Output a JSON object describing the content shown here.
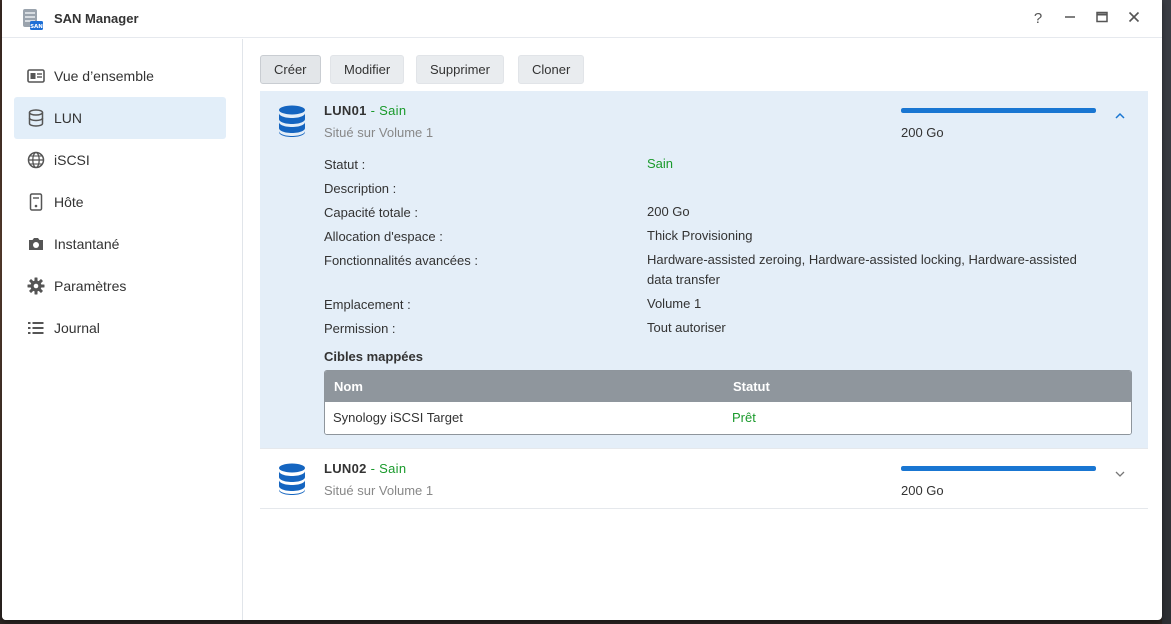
{
  "window": {
    "title": "SAN Manager"
  },
  "titlebar_buttons": {
    "help": "?",
    "minimize": "—",
    "maximize": "▭",
    "close": "✕"
  },
  "sidebar": {
    "items": [
      {
        "label": "Vue d’ensemble",
        "icon": "overview-icon",
        "active": false
      },
      {
        "label": "LUN",
        "icon": "database-icon",
        "active": true
      },
      {
        "label": "iSCSI",
        "icon": "globe-icon",
        "active": false
      },
      {
        "label": "Hôte",
        "icon": "host-icon",
        "active": false
      },
      {
        "label": "Instantané",
        "icon": "camera-icon",
        "active": false
      },
      {
        "label": "Paramètres",
        "icon": "gear-icon",
        "active": false
      },
      {
        "label": "Journal",
        "icon": "list-icon",
        "active": false
      }
    ]
  },
  "toolbar": {
    "create": "Créer",
    "modify": "Modifier",
    "delete": "Supprimer",
    "clone": "Cloner"
  },
  "luns": [
    {
      "name": "LUN01",
      "separator": " - ",
      "status": "Sain",
      "location": "Situé sur Volume 1",
      "capacity": "200 Go",
      "usage_fraction": 1.0,
      "expanded": true,
      "details": [
        {
          "label": "Statut :",
          "value": "Sain"
        },
        {
          "label": "Description :",
          "value": ""
        },
        {
          "label": "Capacité totale :",
          "value": "200 Go"
        },
        {
          "label": "Allocation d'espace :",
          "value": "Thick Provisioning"
        },
        {
          "label": "Fonctionnalités avancées :",
          "value": "Hardware-assisted zeroing, Hardware-assisted locking, Hardware-assisted data transfer"
        },
        {
          "label": "Emplacement :",
          "value": "Volume 1"
        },
        {
          "label": "Permission :",
          "value": "Tout autoriser"
        }
      ],
      "mapped_targets": {
        "title": "Cibles mappées",
        "columns": [
          "Nom",
          "Statut"
        ],
        "rows": [
          {
            "name": "Synology iSCSI Target",
            "status": "Prêt"
          }
        ]
      }
    },
    {
      "name": "LUN02",
      "separator": " - ",
      "status": "Sain",
      "location": "Situé sur Volume 1",
      "capacity": "200 Go",
      "usage_fraction": 1.0,
      "expanded": false
    }
  ],
  "colors": {
    "accent": "#1976d2",
    "healthy": "#1a9a2c",
    "selected_bg": "#e2eef9"
  }
}
